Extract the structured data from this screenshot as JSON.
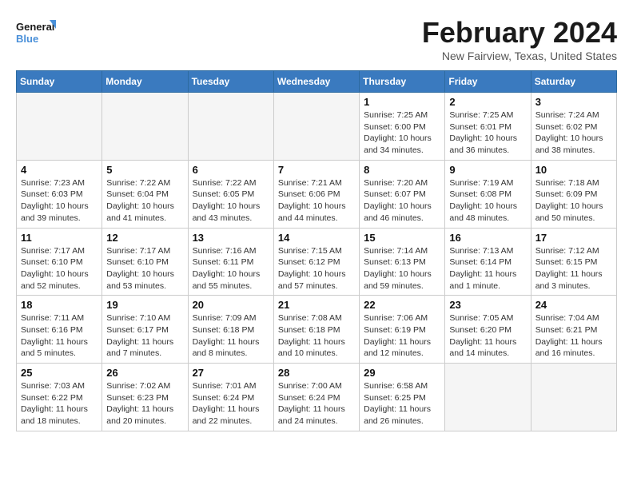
{
  "logo": {
    "line1": "General",
    "line2": "Blue"
  },
  "title": "February 2024",
  "subtitle": "New Fairview, Texas, United States",
  "headers": [
    "Sunday",
    "Monday",
    "Tuesday",
    "Wednesday",
    "Thursday",
    "Friday",
    "Saturday"
  ],
  "weeks": [
    [
      {
        "day": "",
        "info": ""
      },
      {
        "day": "",
        "info": ""
      },
      {
        "day": "",
        "info": ""
      },
      {
        "day": "",
        "info": ""
      },
      {
        "day": "1",
        "info": "Sunrise: 7:25 AM\nSunset: 6:00 PM\nDaylight: 10 hours\nand 34 minutes."
      },
      {
        "day": "2",
        "info": "Sunrise: 7:25 AM\nSunset: 6:01 PM\nDaylight: 10 hours\nand 36 minutes."
      },
      {
        "day": "3",
        "info": "Sunrise: 7:24 AM\nSunset: 6:02 PM\nDaylight: 10 hours\nand 38 minutes."
      }
    ],
    [
      {
        "day": "4",
        "info": "Sunrise: 7:23 AM\nSunset: 6:03 PM\nDaylight: 10 hours\nand 39 minutes."
      },
      {
        "day": "5",
        "info": "Sunrise: 7:22 AM\nSunset: 6:04 PM\nDaylight: 10 hours\nand 41 minutes."
      },
      {
        "day": "6",
        "info": "Sunrise: 7:22 AM\nSunset: 6:05 PM\nDaylight: 10 hours\nand 43 minutes."
      },
      {
        "day": "7",
        "info": "Sunrise: 7:21 AM\nSunset: 6:06 PM\nDaylight: 10 hours\nand 44 minutes."
      },
      {
        "day": "8",
        "info": "Sunrise: 7:20 AM\nSunset: 6:07 PM\nDaylight: 10 hours\nand 46 minutes."
      },
      {
        "day": "9",
        "info": "Sunrise: 7:19 AM\nSunset: 6:08 PM\nDaylight: 10 hours\nand 48 minutes."
      },
      {
        "day": "10",
        "info": "Sunrise: 7:18 AM\nSunset: 6:09 PM\nDaylight: 10 hours\nand 50 minutes."
      }
    ],
    [
      {
        "day": "11",
        "info": "Sunrise: 7:17 AM\nSunset: 6:10 PM\nDaylight: 10 hours\nand 52 minutes."
      },
      {
        "day": "12",
        "info": "Sunrise: 7:17 AM\nSunset: 6:10 PM\nDaylight: 10 hours\nand 53 minutes."
      },
      {
        "day": "13",
        "info": "Sunrise: 7:16 AM\nSunset: 6:11 PM\nDaylight: 10 hours\nand 55 minutes."
      },
      {
        "day": "14",
        "info": "Sunrise: 7:15 AM\nSunset: 6:12 PM\nDaylight: 10 hours\nand 57 minutes."
      },
      {
        "day": "15",
        "info": "Sunrise: 7:14 AM\nSunset: 6:13 PM\nDaylight: 10 hours\nand 59 minutes."
      },
      {
        "day": "16",
        "info": "Sunrise: 7:13 AM\nSunset: 6:14 PM\nDaylight: 11 hours\nand 1 minute."
      },
      {
        "day": "17",
        "info": "Sunrise: 7:12 AM\nSunset: 6:15 PM\nDaylight: 11 hours\nand 3 minutes."
      }
    ],
    [
      {
        "day": "18",
        "info": "Sunrise: 7:11 AM\nSunset: 6:16 PM\nDaylight: 11 hours\nand 5 minutes."
      },
      {
        "day": "19",
        "info": "Sunrise: 7:10 AM\nSunset: 6:17 PM\nDaylight: 11 hours\nand 7 minutes."
      },
      {
        "day": "20",
        "info": "Sunrise: 7:09 AM\nSunset: 6:18 PM\nDaylight: 11 hours\nand 8 minutes."
      },
      {
        "day": "21",
        "info": "Sunrise: 7:08 AM\nSunset: 6:18 PM\nDaylight: 11 hours\nand 10 minutes."
      },
      {
        "day": "22",
        "info": "Sunrise: 7:06 AM\nSunset: 6:19 PM\nDaylight: 11 hours\nand 12 minutes."
      },
      {
        "day": "23",
        "info": "Sunrise: 7:05 AM\nSunset: 6:20 PM\nDaylight: 11 hours\nand 14 minutes."
      },
      {
        "day": "24",
        "info": "Sunrise: 7:04 AM\nSunset: 6:21 PM\nDaylight: 11 hours\nand 16 minutes."
      }
    ],
    [
      {
        "day": "25",
        "info": "Sunrise: 7:03 AM\nSunset: 6:22 PM\nDaylight: 11 hours\nand 18 minutes."
      },
      {
        "day": "26",
        "info": "Sunrise: 7:02 AM\nSunset: 6:23 PM\nDaylight: 11 hours\nand 20 minutes."
      },
      {
        "day": "27",
        "info": "Sunrise: 7:01 AM\nSunset: 6:24 PM\nDaylight: 11 hours\nand 22 minutes."
      },
      {
        "day": "28",
        "info": "Sunrise: 7:00 AM\nSunset: 6:24 PM\nDaylight: 11 hours\nand 24 minutes."
      },
      {
        "day": "29",
        "info": "Sunrise: 6:58 AM\nSunset: 6:25 PM\nDaylight: 11 hours\nand 26 minutes."
      },
      {
        "day": "",
        "info": ""
      },
      {
        "day": "",
        "info": ""
      }
    ]
  ]
}
